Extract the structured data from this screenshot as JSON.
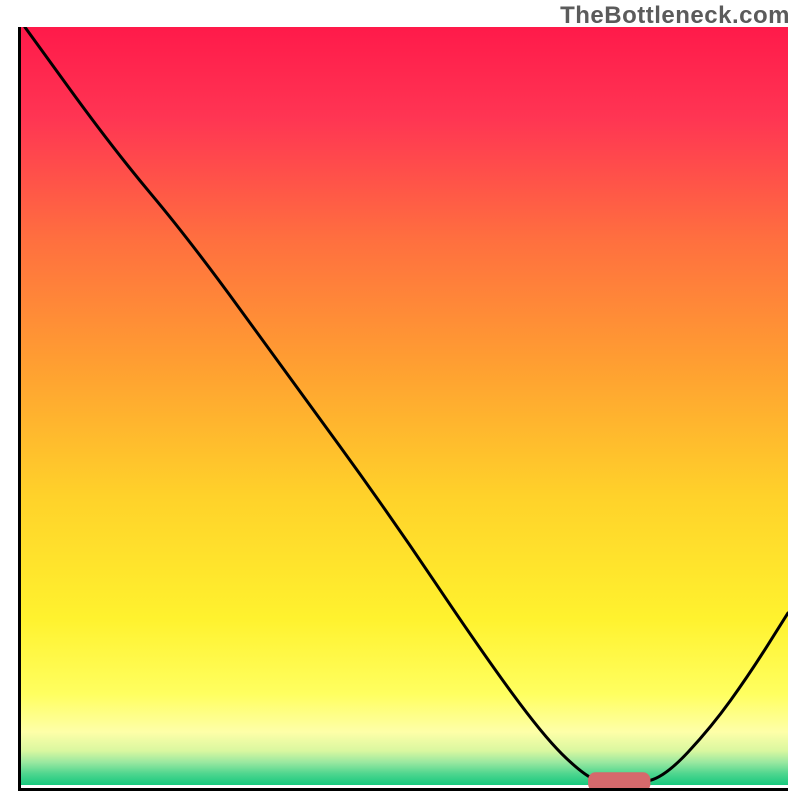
{
  "watermark": "TheBottleneck.com",
  "colors": {
    "border": "#000000",
    "watermark": "#5b5b5b",
    "gradient_stops": [
      {
        "offset": 0.0,
        "color": "#ff1a4a"
      },
      {
        "offset": 0.12,
        "color": "#ff3553"
      },
      {
        "offset": 0.28,
        "color": "#ff6f3f"
      },
      {
        "offset": 0.45,
        "color": "#ffa031"
      },
      {
        "offset": 0.62,
        "color": "#ffd22a"
      },
      {
        "offset": 0.78,
        "color": "#fff22e"
      },
      {
        "offset": 0.88,
        "color": "#ffff60"
      },
      {
        "offset": 0.93,
        "color": "#feffa8"
      },
      {
        "offset": 0.955,
        "color": "#d9f7a0"
      },
      {
        "offset": 0.97,
        "color": "#9ae8a0"
      },
      {
        "offset": 0.985,
        "color": "#4fd68f"
      },
      {
        "offset": 1.0,
        "color": "#18c97e"
      }
    ],
    "curve": "#000000",
    "marker_fill": "#d5696c",
    "marker_stroke": "#d5696c"
  },
  "chart_data": {
    "type": "line",
    "title": "",
    "xlabel": "",
    "ylabel": "",
    "xlim": [
      0,
      100
    ],
    "ylim": [
      0,
      100
    ],
    "series": [
      {
        "name": "bottleneck-curve",
        "x": [
          0.5,
          12,
          22,
          35,
          48,
          60,
          68,
          73,
          76,
          80,
          84,
          90,
          95,
          100
        ],
        "y": [
          100,
          84,
          72,
          54,
          36,
          18,
          7,
          2,
          0.5,
          0.5,
          1.5,
          8,
          15,
          23
        ]
      }
    ],
    "marker": {
      "x_center": 78,
      "y": 0.8,
      "width": 8,
      "height": 2.4
    }
  }
}
